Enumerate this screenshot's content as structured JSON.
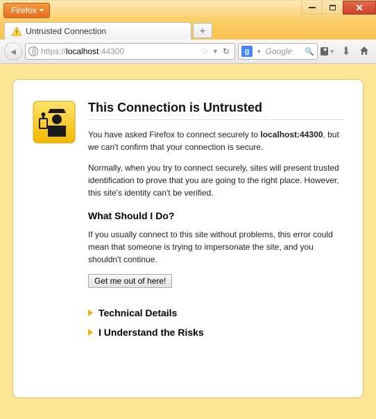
{
  "app": {
    "name": "Firefox"
  },
  "tab": {
    "title": "Untrusted Connection"
  },
  "url": {
    "scheme": "https://",
    "host": "localhost",
    "port": ":44300"
  },
  "search": {
    "placeholder": "Google"
  },
  "page": {
    "title": "This Connection is Untrusted",
    "intro_pre": "You have asked Firefox to connect securely to ",
    "intro_host": "localhost:44300",
    "intro_post": ", but we can't confirm that your connection is secure.",
    "para2": "Normally, when you try to connect securely, sites will present trusted identification to prove that you are going to the right place. However, this site's identity can't be verified.",
    "h2": "What Should I Do?",
    "para3": "If you usually connect to this site without problems, this error could mean that someone is trying to impersonate the site, and you shouldn't continue.",
    "button": "Get me out of here!",
    "tech": "Technical Details",
    "risks": "I Understand the Risks"
  }
}
